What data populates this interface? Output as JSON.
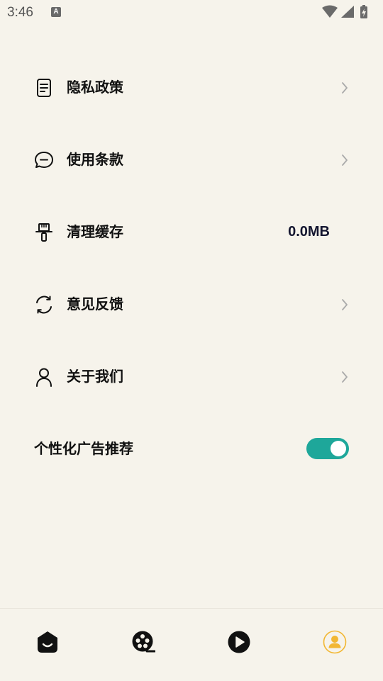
{
  "status_bar": {
    "time": "3:46",
    "notification_badge": "A"
  },
  "menu": [
    {
      "label": "隐私政策",
      "icon": "document-icon",
      "has_chevron": true
    },
    {
      "label": "使用条款",
      "icon": "chat-bubble-icon",
      "has_chevron": true
    },
    {
      "label": "清理缓存",
      "icon": "brush-icon",
      "value": "0.0MB"
    },
    {
      "label": "意见反馈",
      "icon": "refresh-icon",
      "has_chevron": true
    },
    {
      "label": "关于我们",
      "icon": "person-icon",
      "has_chevron": true
    }
  ],
  "ad_toggle": {
    "label": "个性化广告推荐",
    "enabled": true,
    "color": "#1ea79a"
  },
  "bottom_nav": [
    {
      "icon": "home-face-icon",
      "active": false
    },
    {
      "icon": "film-reel-icon",
      "active": false
    },
    {
      "icon": "play-icon",
      "active": false
    },
    {
      "icon": "profile-icon",
      "active": true,
      "color": "#f2b733"
    }
  ]
}
